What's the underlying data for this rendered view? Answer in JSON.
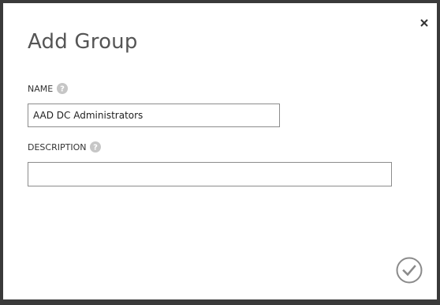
{
  "dialog": {
    "title": "Add Group",
    "close_icon": "close-icon",
    "confirm_icon": "checkmark-circle-icon"
  },
  "fields": {
    "name": {
      "label": "NAME",
      "value": "AAD DC Administrators",
      "help_icon": "help-icon"
    },
    "description": {
      "label": "DESCRIPTION",
      "value": "",
      "help_icon": "help-icon"
    }
  },
  "colors": {
    "frame": "#3a3a3a",
    "background": "#ffffff",
    "title_text": "#555555",
    "help_icon": "#c6c6c6",
    "input_border": "#8c8c8c",
    "confirm_icon": "#8a8a8a"
  }
}
